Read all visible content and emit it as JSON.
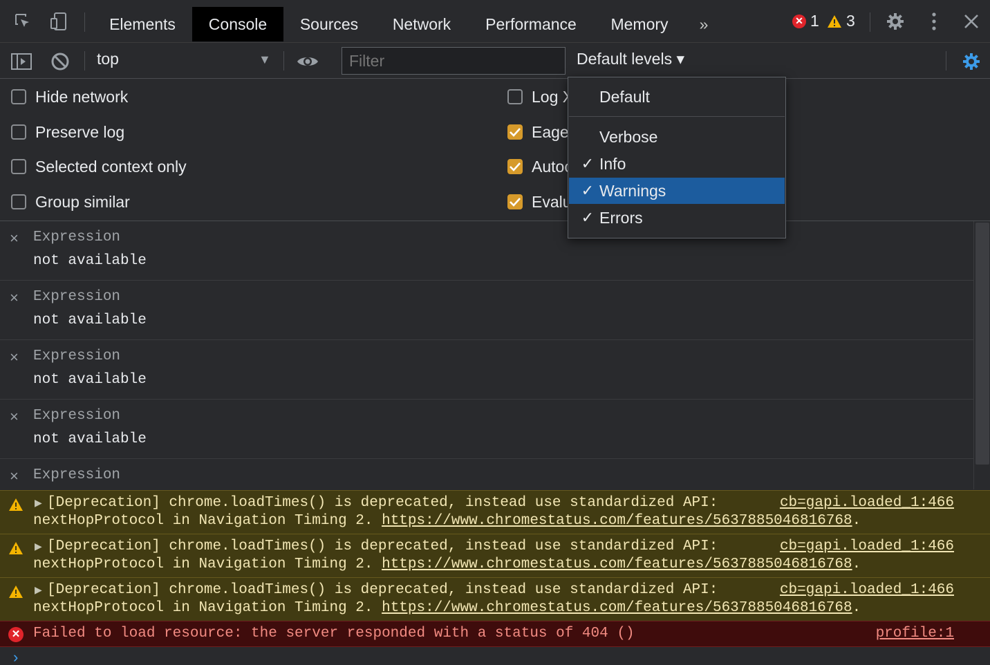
{
  "tabs": [
    {
      "label": "Elements"
    },
    {
      "label": "Console",
      "active": true
    },
    {
      "label": "Sources"
    },
    {
      "label": "Network"
    },
    {
      "label": "Performance"
    },
    {
      "label": "Memory"
    }
  ],
  "more_tabs_icon": "»",
  "counts": {
    "errors": "1",
    "warnings": "3"
  },
  "toolbar": {
    "context": "top",
    "filter_placeholder": "Filter",
    "levels_label": "Default levels ▾"
  },
  "settings": {
    "left": [
      {
        "label": "Hide network",
        "checked": false
      },
      {
        "label": "Preserve log",
        "checked": false
      },
      {
        "label": "Selected context only",
        "checked": false
      },
      {
        "label": "Group similar",
        "checked": false
      }
    ],
    "right": [
      {
        "label": "Log X",
        "checked": false
      },
      {
        "label": "Eage",
        "checked": true
      },
      {
        "label": "Autoc",
        "checked": true
      },
      {
        "label": "Evalu",
        "checked": true
      }
    ]
  },
  "expressions": [
    {
      "name": "Expression",
      "value": "not available"
    },
    {
      "name": "Expression",
      "value": "not available"
    },
    {
      "name": "Expression",
      "value": "not available"
    },
    {
      "name": "Expression",
      "value": "not available"
    },
    {
      "name": "Expression",
      "value": ""
    }
  ],
  "messages": [
    {
      "type": "warning",
      "line1": "[Deprecation] chrome.loadTimes() is deprecated, instead use standardized API:",
      "line2_pre": "nextHopProtocol in Navigation Timing 2. ",
      "link": "https://www.chromestatus.com/features/5637885046816768",
      "line2_post": ".",
      "source": "cb=gapi.loaded_1:466"
    },
    {
      "type": "warning",
      "line1": "[Deprecation] chrome.loadTimes() is deprecated, instead use standardized API:",
      "line2_pre": "nextHopProtocol in Navigation Timing 2. ",
      "link": "https://www.chromestatus.com/features/5637885046816768",
      "line2_post": ".",
      "source": "cb=gapi.loaded_1:466"
    },
    {
      "type": "warning",
      "line1": "[Deprecation] chrome.loadTimes() is deprecated, instead use standardized API:",
      "line2_pre": "nextHopProtocol in Navigation Timing 2. ",
      "link": "https://www.chromestatus.com/features/5637885046816768",
      "line2_post": ".",
      "source": "cb=gapi.loaded_1:466"
    },
    {
      "type": "error",
      "text": "Failed to load resource: the server responded with a status of 404 ()",
      "source": "profile:1"
    }
  ],
  "prompt": "›",
  "levels_menu": {
    "default": "Default",
    "items": [
      {
        "label": "Verbose",
        "checked": false
      },
      {
        "label": "Info",
        "checked": true
      },
      {
        "label": "Warnings",
        "checked": true,
        "highlighted": true
      },
      {
        "label": "Errors",
        "checked": true
      }
    ]
  },
  "colors": {
    "accent": "#3c9be8",
    "checkbox": "#d69a2b",
    "highlight": "#1c5c9e",
    "error": "#e0242b",
    "warning_bg": "#413b12"
  }
}
